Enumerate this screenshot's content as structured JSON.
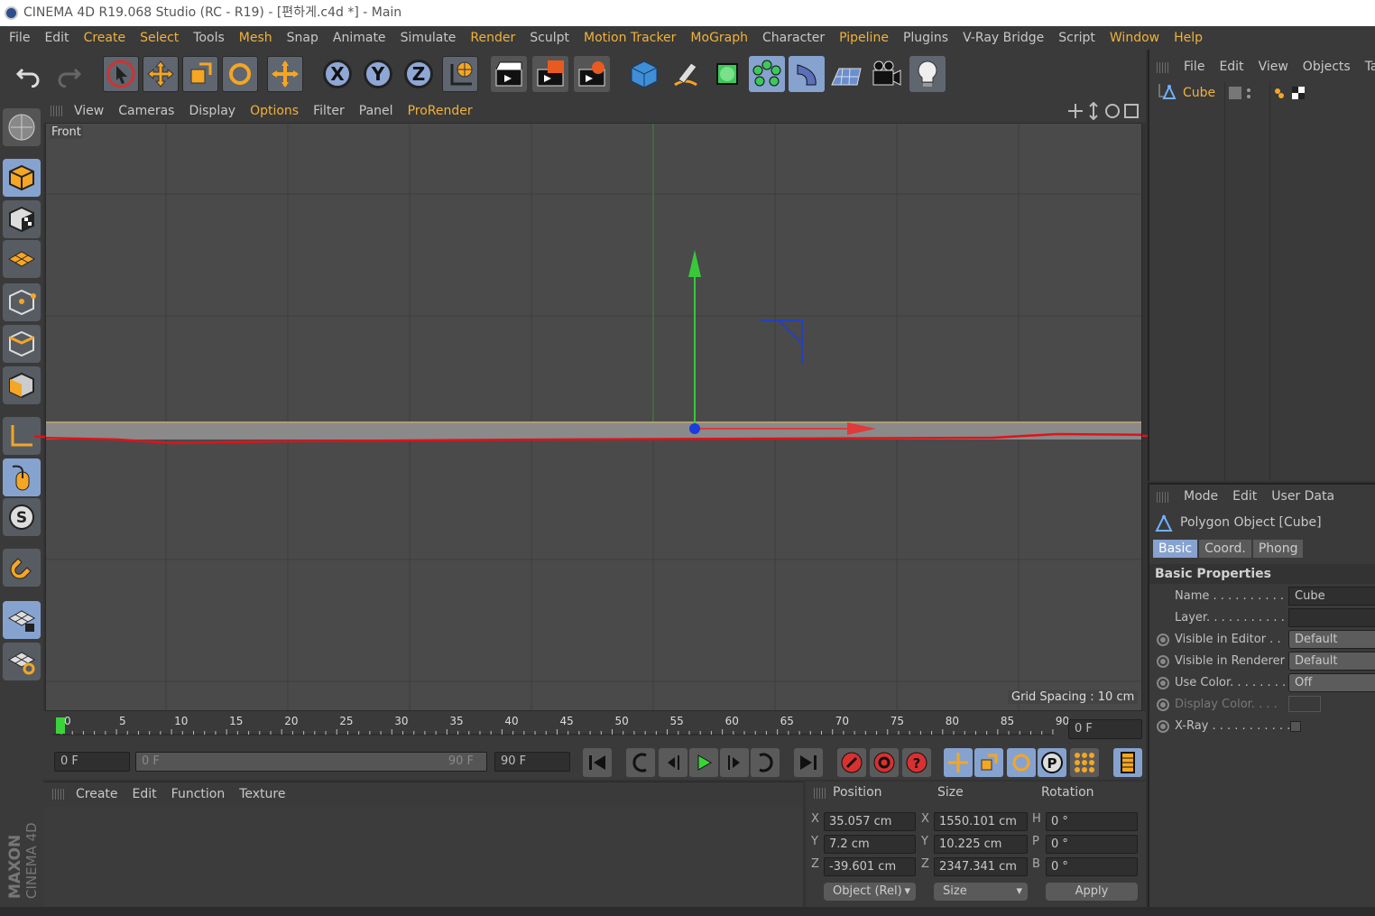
{
  "window": {
    "title": "CINEMA 4D R19.068 Studio (RC - R19) - [편하게.c4d *] - Main"
  },
  "menubar": {
    "items": [
      {
        "label": "File",
        "hl": false
      },
      {
        "label": "Edit",
        "hl": false
      },
      {
        "label": "Create",
        "hl": true
      },
      {
        "label": "Select",
        "hl": true
      },
      {
        "label": "Tools",
        "hl": false
      },
      {
        "label": "Mesh",
        "hl": true
      },
      {
        "label": "Snap",
        "hl": false
      },
      {
        "label": "Animate",
        "hl": false
      },
      {
        "label": "Simulate",
        "hl": false
      },
      {
        "label": "Render",
        "hl": true
      },
      {
        "label": "Sculpt",
        "hl": false
      },
      {
        "label": "Motion Tracker",
        "hl": true
      },
      {
        "label": "MoGraph",
        "hl": true
      },
      {
        "label": "Character",
        "hl": false
      },
      {
        "label": "Pipeline",
        "hl": true
      },
      {
        "label": "Plugins",
        "hl": false
      },
      {
        "label": "V-Ray Bridge",
        "hl": false
      },
      {
        "label": "Script",
        "hl": false
      },
      {
        "label": "Window",
        "hl": true
      },
      {
        "label": "Help",
        "hl": true
      }
    ]
  },
  "toolbar": {
    "axis_x": "X",
    "axis_y": "Y",
    "axis_z": "Z"
  },
  "viewport": {
    "menu": [
      {
        "label": "View",
        "hl": false
      },
      {
        "label": "Cameras",
        "hl": false
      },
      {
        "label": "Display",
        "hl": false
      },
      {
        "label": "Options",
        "hl": true
      },
      {
        "label": "Filter",
        "hl": false
      },
      {
        "label": "Panel",
        "hl": false
      },
      {
        "label": "ProRender",
        "hl": true
      }
    ],
    "view_name": "Front",
    "grid_spacing": "Grid Spacing : 10 cm"
  },
  "timeline": {
    "ticks": [
      "0",
      "5",
      "10",
      "15",
      "20",
      "25",
      "30",
      "35",
      "40",
      "45",
      "50",
      "55",
      "60",
      "65",
      "70",
      "75",
      "80",
      "85",
      "90"
    ],
    "current_frame": "0 F",
    "start_field": "0 F",
    "range_start": "0 F",
    "range_end": "90 F",
    "end_field": "90 F",
    "playhead_fraction": 0.0
  },
  "material_panel": {
    "menu": [
      "Create",
      "Edit",
      "Function",
      "Texture"
    ]
  },
  "coordinates": {
    "headers": {
      "position": "Position",
      "size": "Size",
      "rotation": "Rotation"
    },
    "rows": [
      {
        "axis": "X",
        "pos": "35.057 cm",
        "size_axis": "X",
        "size": "1550.101 cm",
        "rot_axis": "H",
        "rot": "0 °"
      },
      {
        "axis": "Y",
        "pos": "7.2 cm",
        "size_axis": "Y",
        "size": "10.225 cm",
        "rot_axis": "P",
        "rot": "0 °"
      },
      {
        "axis": "Z",
        "pos": "-39.601 cm",
        "size_axis": "Z",
        "size": "2347.341 cm",
        "rot_axis": "B",
        "rot": "0 °"
      }
    ],
    "mode_dropdown": "Object (Rel)",
    "size_dropdown": "Size",
    "apply_label": "Apply"
  },
  "object_manager": {
    "menu": [
      "File",
      "Edit",
      "View",
      "Objects",
      "Tag"
    ],
    "objects": [
      {
        "name": "Cube"
      }
    ]
  },
  "attribute_manager": {
    "menu": [
      "Mode",
      "Edit",
      "User Data"
    ],
    "object_title": "Polygon Object [Cube]",
    "tabs": [
      {
        "label": "Basic",
        "active": true
      },
      {
        "label": "Coord.",
        "active": false
      },
      {
        "label": "Phong",
        "active": false
      }
    ],
    "section_title": "Basic Properties",
    "rows": [
      {
        "label": "Name . . . . . . . . . . .",
        "value": "Cube",
        "radio": false,
        "button": false
      },
      {
        "label": "Layer. . . . . . . . . . . .",
        "value": "",
        "radio": false,
        "button": false
      },
      {
        "label": "Visible in Editor . .",
        "value": "Default",
        "radio": true,
        "button": true
      },
      {
        "label": "Visible in Renderer",
        "value": "Default",
        "radio": true,
        "button": true
      },
      {
        "label": "Use Color. . . . . . . .",
        "value": "Off",
        "radio": true,
        "button": true
      },
      {
        "label": "Display Color. . . .",
        "value": "",
        "radio": true,
        "button": false,
        "dim": true
      },
      {
        "label": "X-Ray . . . . . . . . . . .",
        "value": "",
        "radio": true,
        "checkbox": true
      }
    ]
  },
  "brand": {
    "maxon": "MAXON",
    "product": "CINEMA 4D"
  },
  "colors": {
    "accent": "#f0b23a",
    "tool_blue": "#86a2cf",
    "axis_x": "#e03a3a",
    "axis_y": "#39c83a",
    "axis_z": "#1a3de0"
  }
}
